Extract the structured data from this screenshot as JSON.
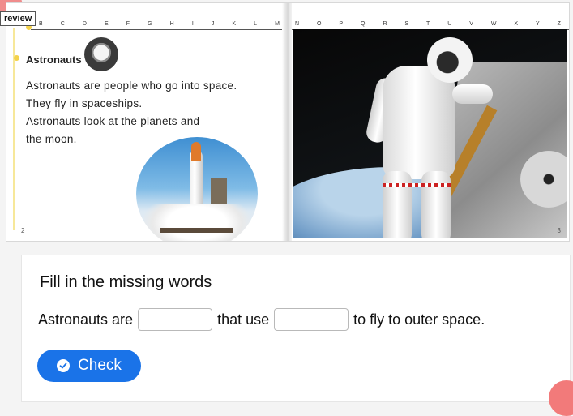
{
  "review_tab": {
    "label": "review"
  },
  "book": {
    "left_page": {
      "letters": [
        "B",
        "C",
        "D",
        "E",
        "F",
        "G",
        "H",
        "I",
        "J",
        "K",
        "L",
        "M"
      ],
      "title": "Astronauts",
      "lines": [
        "Astronauts are people who go into space.",
        "They fly in spaceships.",
        "Astronauts look at the planets and",
        "the moon."
      ],
      "page_number": "2"
    },
    "right_page": {
      "letters": [
        "N",
        "O",
        "P",
        "Q",
        "R",
        "S",
        "T",
        "U",
        "V",
        "W",
        "X",
        "Y",
        "Z"
      ],
      "page_number": "3"
    }
  },
  "exercise": {
    "title": "Fill in the missing words",
    "sentence": {
      "part1": "Astronauts are",
      "input1": {
        "value": "",
        "placeholder": ""
      },
      "part2": "that use",
      "input2": {
        "value": "",
        "placeholder": ""
      },
      "part3": "to fly to outer space."
    },
    "check_button": {
      "label": "Check",
      "icon": "check-circle-icon"
    }
  },
  "colors": {
    "accent": "#1a73e8",
    "decor_pink": "#f27a7a",
    "margin_yellow": "#f4d24a"
  }
}
